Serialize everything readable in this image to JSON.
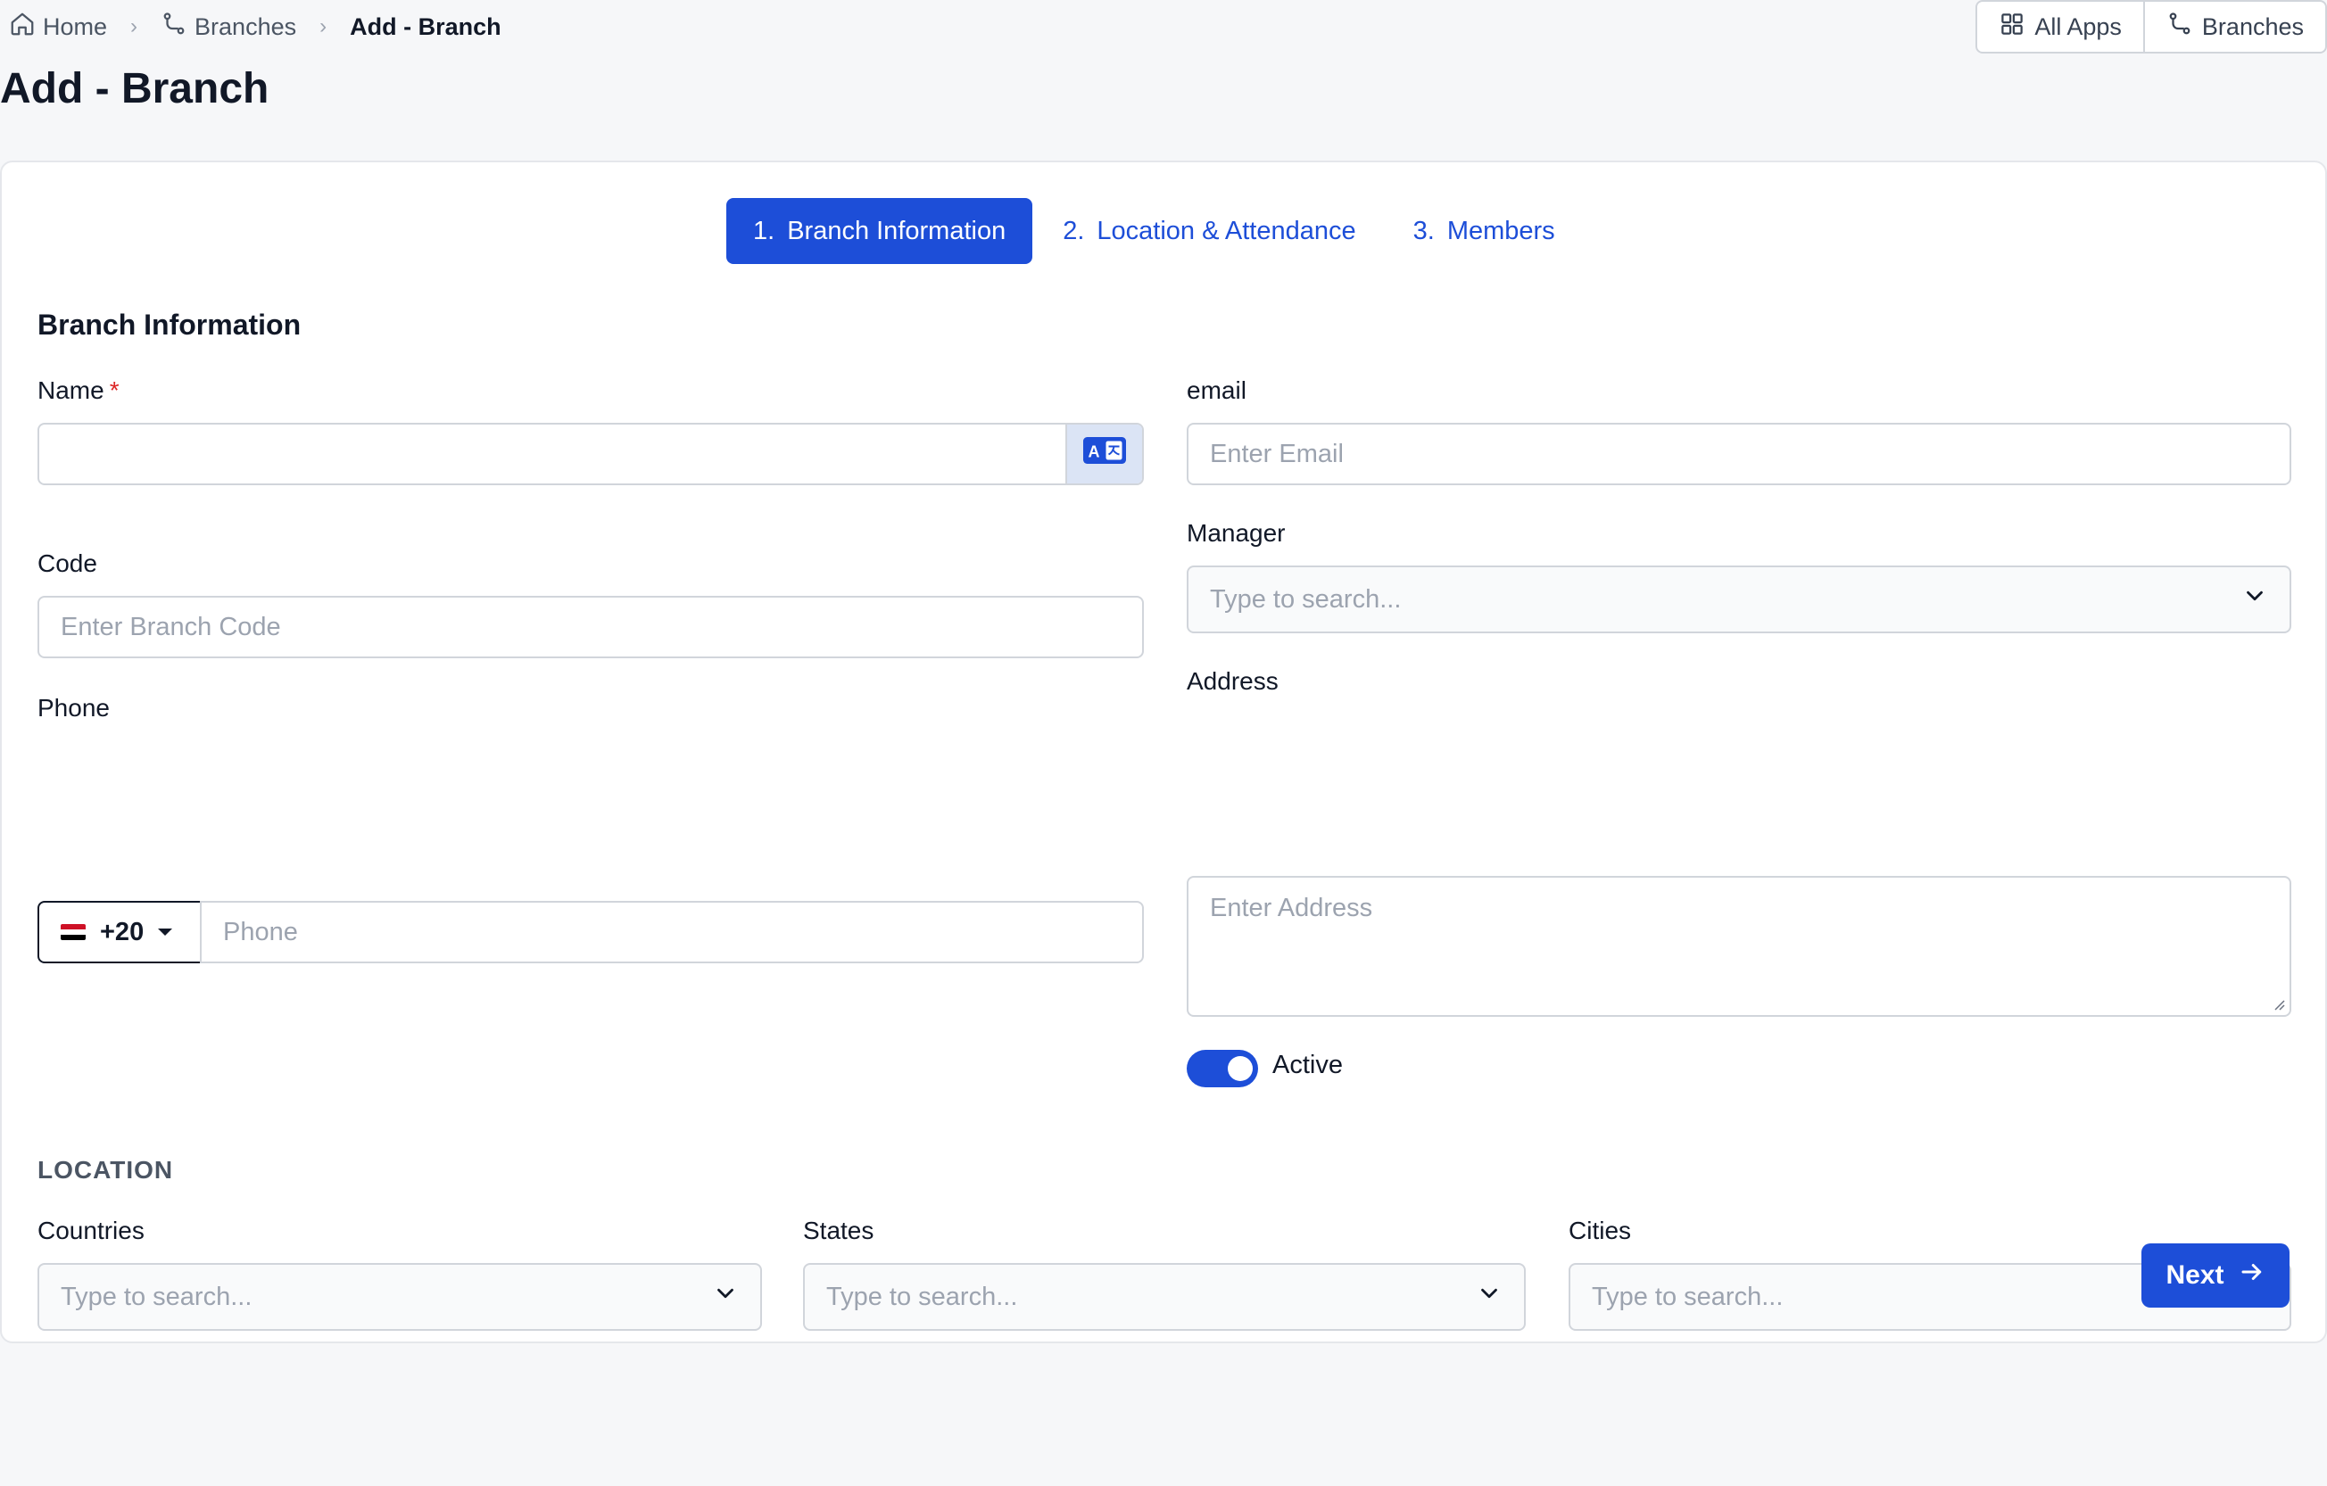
{
  "breadcrumb": {
    "home": "Home",
    "branches": "Branches",
    "current": "Add - Branch"
  },
  "top_actions": {
    "all_apps": "All Apps",
    "branches": "Branches"
  },
  "page_title": "Add - Branch",
  "steps": [
    {
      "num": "1.",
      "label": "Branch Information",
      "active": true
    },
    {
      "num": "2.",
      "label": "Location & Attendance",
      "active": false
    },
    {
      "num": "3.",
      "label": "Members",
      "active": false
    }
  ],
  "form": {
    "section_title": "Branch Information",
    "name": {
      "label": "Name",
      "required_mark": "*",
      "value": ""
    },
    "email": {
      "label": "email",
      "placeholder": "Enter Email"
    },
    "code": {
      "label": "Code",
      "placeholder": "Enter Branch Code"
    },
    "manager": {
      "label": "Manager",
      "placeholder": "Type to search..."
    },
    "phone": {
      "label": "Phone",
      "country_code": "+20",
      "placeholder": "Phone"
    },
    "address": {
      "label": "Address",
      "placeholder": "Enter Address"
    },
    "active": {
      "label": "Active",
      "checked": true
    }
  },
  "location": {
    "title": "LOCATION",
    "countries": {
      "label": "Countries",
      "placeholder": "Type to search..."
    },
    "states": {
      "label": "States",
      "placeholder": "Type to search..."
    },
    "cities": {
      "label": "Cities",
      "placeholder": "Type to search..."
    }
  },
  "next_label": "Next",
  "colors": {
    "accent": "#1d4ed8",
    "page_bg": "#f6f7f9",
    "required": "#dc2626"
  },
  "icons": {
    "home": "home-icon",
    "branches": "branch-icon",
    "all_apps": "grid-icon",
    "translate": "translate-icon",
    "chevron": "chevron-down-icon",
    "next": "arrow-right-icon"
  }
}
